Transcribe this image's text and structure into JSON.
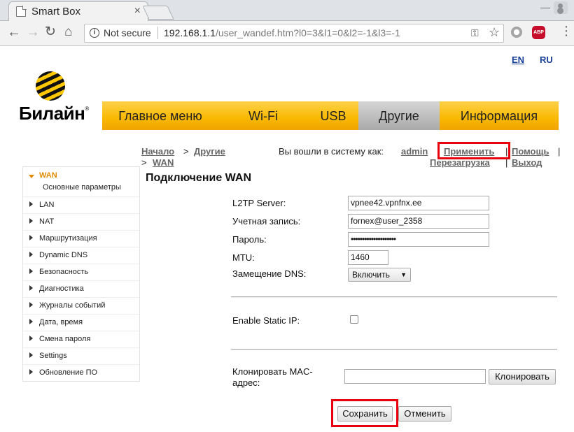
{
  "browser": {
    "tab_title": "Smart Box",
    "tab_close": "×",
    "not_secure": "Not secure",
    "url_host": "192.168.1.1",
    "url_path": "/user_wandef.htm?l0=3&l1=0&l2=-1&l3=-1"
  },
  "lang": {
    "en": "EN",
    "ru": "RU"
  },
  "logo": {
    "text": "Билайн",
    "mark": "®"
  },
  "mainnav": [
    "Главное меню",
    "Wi-Fi",
    "USB",
    "Другие",
    "Информация"
  ],
  "breadcrumb": {
    "home": "Начало",
    "sep": ">",
    "other": "Другие",
    "wan": "WAN"
  },
  "session": {
    "logged_in_as": "Вы вошли в систему как:",
    "user": "admin",
    "apply": "Применить",
    "help": "Помощь",
    "reboot": "Перезагрузка",
    "exit": "Выход",
    "pipe": "|"
  },
  "sidebar": {
    "active": "WAN",
    "active_sub": "Основные параметры",
    "items": [
      "LAN",
      "NAT",
      "Маршрутизация",
      "Dynamic DNS",
      "Безопасность",
      "Диагностика",
      "Журналы событий",
      "Дата, время",
      "Смена пароля",
      "Settings",
      "Обновление ПО"
    ]
  },
  "form": {
    "title": "Подключение WAN",
    "server_label": "L2TP Server:",
    "server_value": "vpnee42.vpnfnx.ee",
    "account_label": "Учетная запись:",
    "account_value": "fornex@user_2358",
    "password_label": "Пароль:",
    "password_value": "••••••••••••••••••••",
    "mtu_label": "MTU:",
    "mtu_value": "1460",
    "dns_label": "Замещение DNS:",
    "dns_value": "Включить",
    "static_ip_label": "Enable Static IP:",
    "mac_label": "Клонировать MAC-адрес:",
    "clone_button": "Клонировать",
    "save_button": "Сохранить",
    "cancel_button": "Отменить"
  }
}
